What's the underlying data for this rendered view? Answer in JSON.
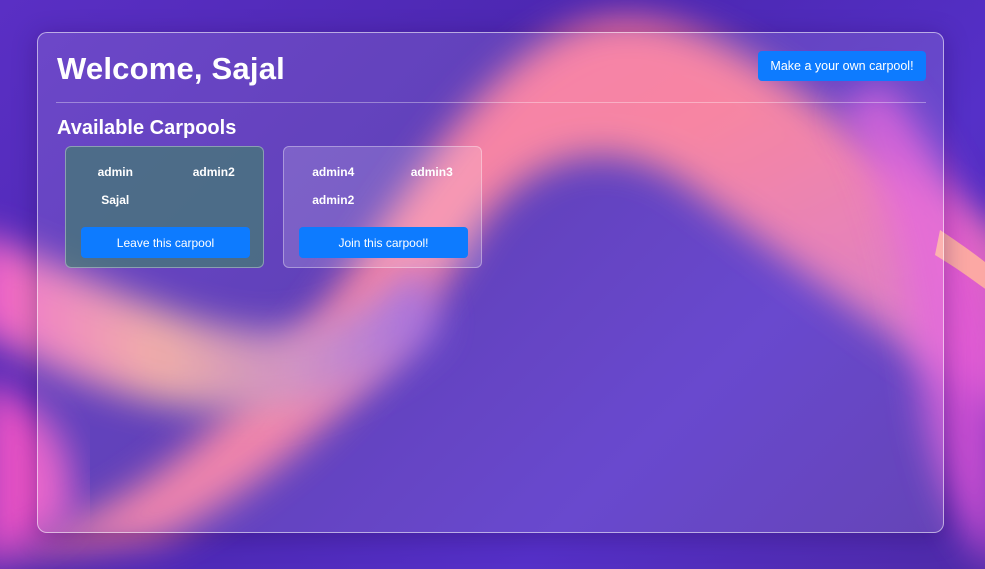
{
  "header": {
    "welcome": "Welcome, Sajal",
    "make_carpool_label": "Make a your own carpool!"
  },
  "section_title": "Available Carpools",
  "carpools": [
    {
      "members": [
        "admin",
        "admin2",
        "Sajal"
      ],
      "action_label": "Leave this carpool",
      "joined": true
    },
    {
      "members": [
        "admin4",
        "admin3",
        "admin2"
      ],
      "action_label": "Join this carpool!",
      "joined": false
    }
  ],
  "colors": {
    "button": "#0d7bff",
    "background": "#4a2bb3",
    "joined_card": "#467878"
  }
}
